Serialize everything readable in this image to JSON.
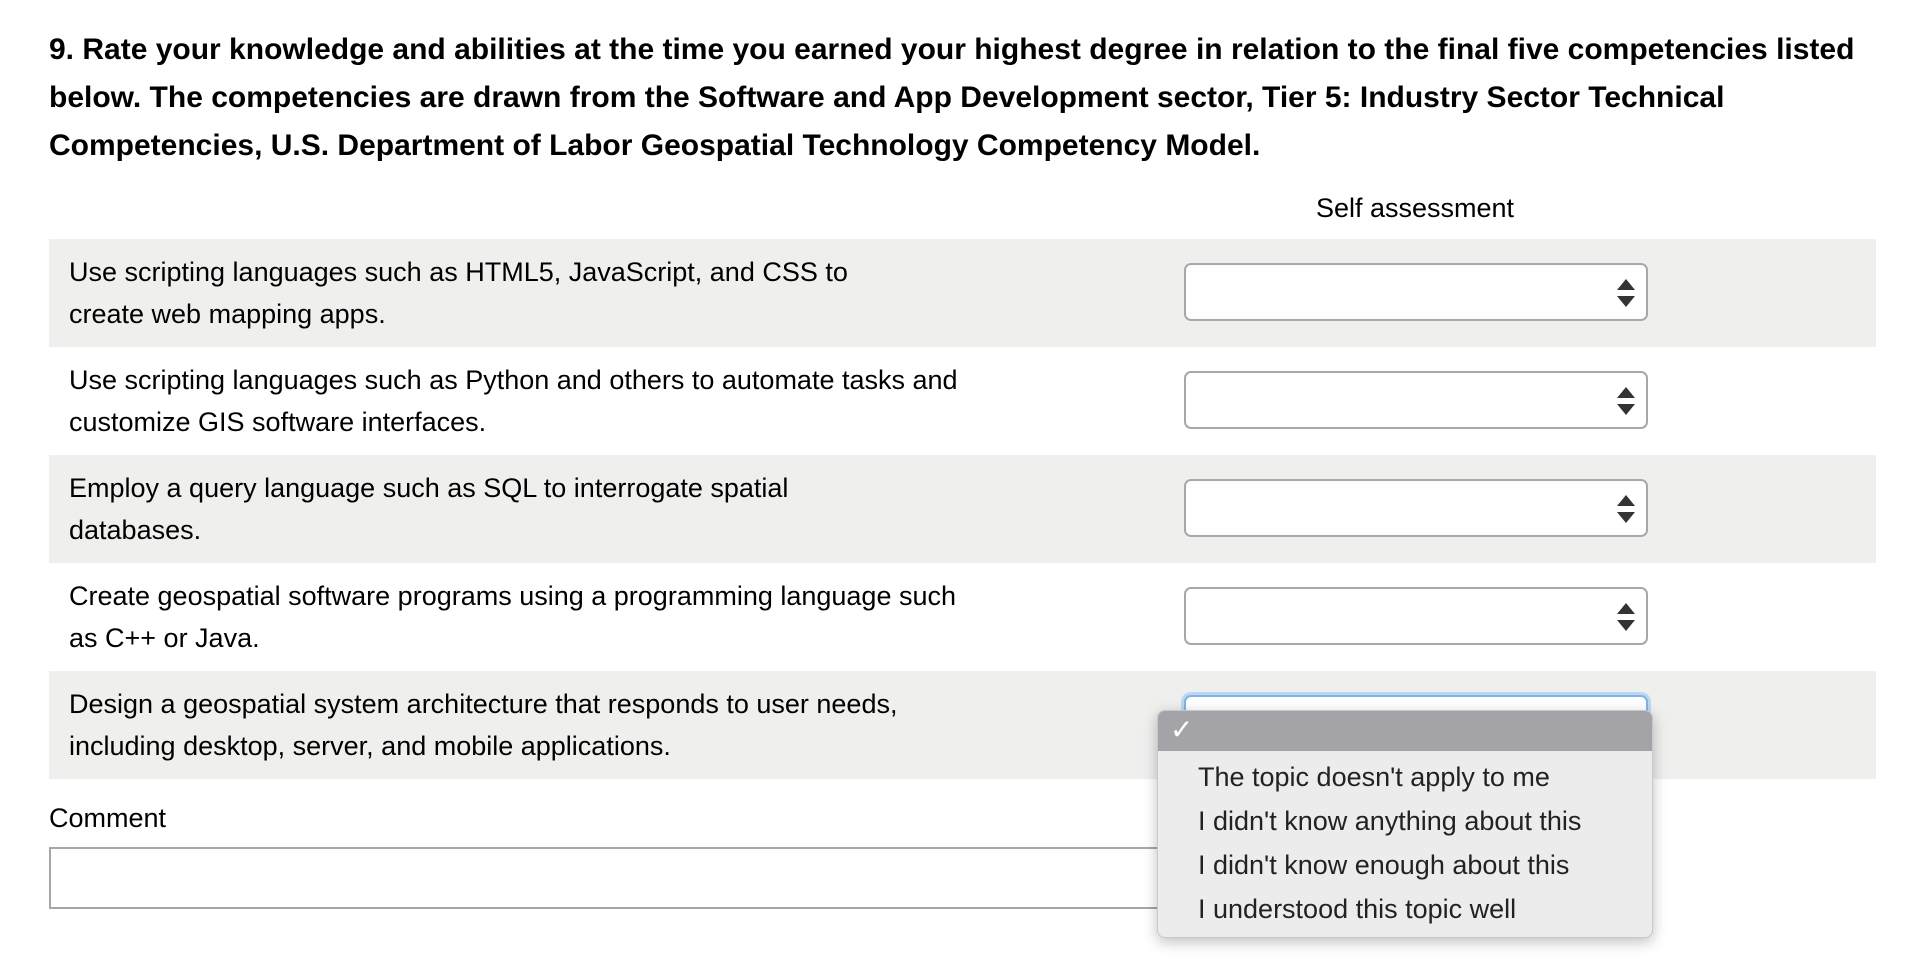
{
  "question": {
    "text": "9. Rate your knowledge and abilities at the time you earned your highest degree in relation to the final five competencies listed below. The competencies are drawn from the Software and App Development sector, Tier 5: Industry Sector Technical Competencies, U.S. Department of Labor Geospatial Technology Competency Model."
  },
  "table": {
    "column_header": "Self assessment",
    "rows": [
      {
        "label": "Use scripting languages such as HTML5, JavaScript, and CSS to create web mapping apps.",
        "value": ""
      },
      {
        "label": "Use scripting languages such as Python and others to automate tasks and customize GIS software interfaces.",
        "value": ""
      },
      {
        "label": "Employ a query language such as SQL to interrogate spatial databases.",
        "value": ""
      },
      {
        "label": "Create geospatial software programs using a programming language such as C++ or Java.",
        "value": ""
      },
      {
        "label": "Design a geospatial system architecture that responds to user needs, including desktop, server, and mobile applications.",
        "value": ""
      }
    ]
  },
  "comment": {
    "label": "Comment",
    "value": ""
  },
  "dropdown": {
    "selected_marker": "✓",
    "options": [
      "The topic doesn't apply to me",
      "I didn't know anything about this",
      "I didn't know enough about this",
      "I understood this topic well"
    ]
  },
  "colors": {
    "row_shade": "#efefee",
    "dropdown_highlight": "#a4a4a8",
    "focus_ring": "#7fb2e6"
  },
  "icons": {
    "select_arrows": "up-down-chevron-icon",
    "selected_check": "checkmark-icon"
  }
}
